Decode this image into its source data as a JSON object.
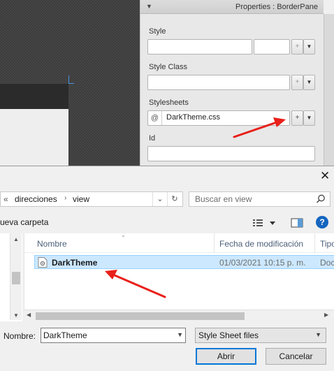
{
  "scene_builder": {
    "properties_title": "Properties : BorderPane",
    "style_label": "Style",
    "style_class_label": "Style Class",
    "stylesheets_label": "Stylesheets",
    "stylesheet_prefix": "@",
    "stylesheet_value": "DarkTheme.css",
    "id_label": "Id",
    "add_symbol": "+"
  },
  "dialog": {
    "breadcrumb": {
      "overflow": "«",
      "items": [
        "direcciones",
        "view"
      ]
    },
    "search_placeholder": "Buscar en view",
    "new_folder_label": "ueva carpeta",
    "help_symbol": "?",
    "columns": {
      "name": "Nombre",
      "date": "Fecha de modificación",
      "type": "Tipo"
    },
    "files": [
      {
        "name": "DarkTheme",
        "date": "01/03/2021 10:15 p. m.",
        "type": "Doc"
      }
    ],
    "filename_label": "Nombre:",
    "filename_value": "DarkTheme",
    "filetype_value": "Style Sheet files",
    "open_label": "Abrir",
    "cancel_label": "Cancelar"
  },
  "colors": {
    "selection": "#cce8ff",
    "annotation_arrow": "#e8201a",
    "accent": "#0078d7"
  }
}
